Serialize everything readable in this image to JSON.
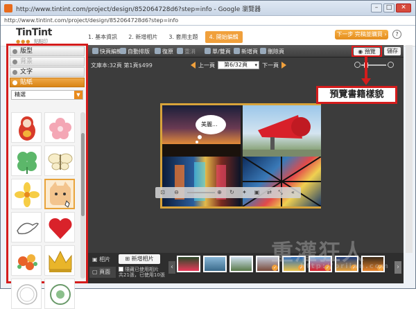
{
  "browser": {
    "title": "http://www.tintint.com/project/design/852064728d6?step=info - Google 瀏覽器",
    "url": "http://www.tintint.com/project/design/852064728d6?step=info",
    "buttons": {
      "minimize": "–",
      "maximize": "□",
      "close": "✕"
    }
  },
  "header": {
    "logo": "TinTint",
    "logo_sub": "點點印",
    "steps": [
      {
        "label": "1. 基本資訊"
      },
      {
        "label": "2. 新增相片"
      },
      {
        "label": "3. 套用主題"
      },
      {
        "label": "4. 開始編輯"
      }
    ],
    "next_button": "下一步 完稿並購買 ›",
    "help": "?"
  },
  "sidebar": {
    "sections": [
      {
        "label": "版型"
      },
      {
        "label": "背景"
      },
      {
        "label": "文字"
      },
      {
        "label": "貼紙"
      }
    ],
    "filter": "精選"
  },
  "toolbar": {
    "items": [
      {
        "label": "快頁編輯"
      },
      {
        "label": "自動排版"
      },
      {
        "label": "復原"
      },
      {
        "label": "重消"
      },
      {
        "label": "單/雙頁"
      },
      {
        "label": "新增頁"
      },
      {
        "label": "刪除頁"
      }
    ],
    "preview": "預覽",
    "save": "儲存"
  },
  "editor": {
    "status": "文庫本:32頁 第1頁$499",
    "prev_page": "上一頁",
    "page_select": "第6/32頁",
    "next_page": "下一頁",
    "speech_bubble": "美麗..."
  },
  "callout": {
    "text": "預覽書籍樣貌"
  },
  "bottom": {
    "tabs": [
      {
        "label": "相片"
      },
      {
        "label": "頁面"
      }
    ],
    "add_photo": "新增相片",
    "hide_used_line1": "隱藏已使用相片",
    "hide_used_line2": "共21張，已使用10張"
  },
  "watermark": {
    "text": "重灌狂人",
    "sub": "http://briian.com"
  },
  "colors": {
    "accent": "#f0a03c",
    "highlight": "#d41c1c",
    "editor_bg": "#3c3c3c"
  }
}
